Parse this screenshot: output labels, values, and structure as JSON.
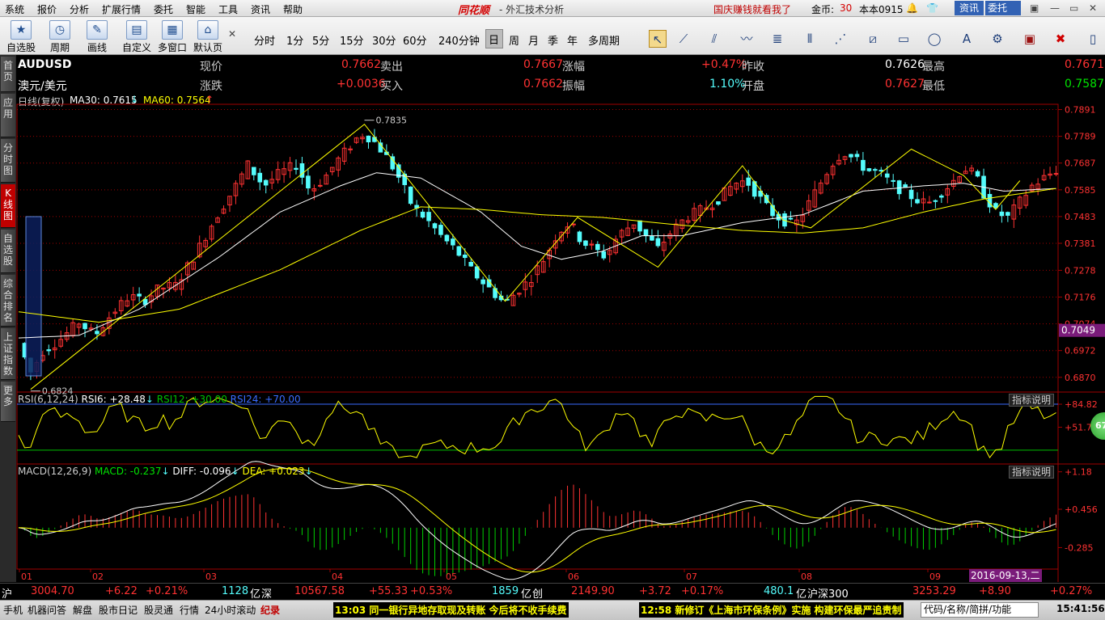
{
  "menubar": {
    "items": [
      "系统",
      "报价",
      "分析",
      "扩展行情",
      "委托",
      "智能",
      "工具",
      "资讯",
      "帮助"
    ],
    "brand": "同花顺",
    "title": "- 外汇技术分析",
    "promo": "国庆赚钱就看我了",
    "coins_label": "金币:",
    "coins": "30",
    "version": "本本0915",
    "btn_news": "资讯",
    "btn_trade": "委托"
  },
  "toolbar": {
    "buttons": [
      "自选股",
      "周期",
      "画线",
      "自定义",
      "多窗口",
      "默认页"
    ],
    "periods": [
      "分时",
      "1分",
      "5分",
      "15分",
      "30分",
      "60分",
      "240分钟",
      "日",
      "周",
      "月",
      "季",
      "年",
      "多周期"
    ]
  },
  "leftbar": {
    "tabs": [
      "首页",
      "应用",
      "分时图",
      "K线图",
      "自选股",
      "综合排名",
      "上证指数",
      "更多"
    ]
  },
  "quote": {
    "symbol": "AUDUSD",
    "name": "澳元/美元",
    "labels": {
      "now": "现价",
      "change": "涨跌",
      "sell": "卖出",
      "buy": "买入",
      "pct": "涨幅",
      "amp": "振幅",
      "prev": "昨收",
      "open": "开盘",
      "high": "最高",
      "low": "最低"
    },
    "now": "0.7662",
    "change": "+0.0036",
    "sell": "0.7667",
    "buy": "0.7662",
    "pct": "+0.47%",
    "amp": "1.10%",
    "prev": "0.7626",
    "open": "0.7627",
    "high": "0.7671",
    "low": "0.7587"
  },
  "kline_header": {
    "label": "日线(复权)",
    "ma30_label": "MA30: 0.7615",
    "ma60_label": "MA60: 0.7564"
  },
  "rsi_header": {
    "name": "RSI(6,12,24)",
    "rsi6": "RSI6: +28.48",
    "rsi12": "RSI12: +30.00",
    "rsi24": "RSI24: +70.00"
  },
  "macd_header": {
    "name": "MACD(12,26,9)",
    "macd": "MACD: -0.237",
    "diff": "DIFF: -0.096",
    "dea": "DEA: +0.023"
  },
  "indicator_btn": "指标说明",
  "round_badge": "67",
  "date_label": "2016-09-13,二",
  "chart_data": [
    {
      "type": "candlestick",
      "yticks": [
        0.7891,
        0.7789,
        0.7687,
        0.7585,
        0.7483,
        0.7381,
        0.7278,
        0.7176,
        0.7074,
        0.6972,
        0.687
      ],
      "ylim": [
        0.682,
        0.7905
      ],
      "xticks": [
        "01",
        "02",
        "03",
        "04",
        "05",
        "06",
        "07",
        "08",
        "09"
      ],
      "price_marker": "0.7049",
      "annot_high": "0.7835",
      "annot_low": "0.6824",
      "close_anchors": [
        [
          0,
          0.7
        ],
        [
          6,
          0.689
        ],
        [
          12,
          0.697
        ],
        [
          20,
          0.701
        ],
        [
          30,
          0.708
        ],
        [
          38,
          0.703
        ],
        [
          46,
          0.711
        ],
        [
          55,
          0.718
        ],
        [
          62,
          0.716
        ],
        [
          70,
          0.721
        ],
        [
          78,
          0.722
        ],
        [
          88,
          0.734
        ],
        [
          98,
          0.748
        ],
        [
          108,
          0.76
        ],
        [
          114,
          0.768
        ],
        [
          122,
          0.76
        ],
        [
          130,
          0.765
        ],
        [
          138,
          0.768
        ],
        [
          145,
          0.758
        ],
        [
          152,
          0.763
        ],
        [
          160,
          0.771
        ],
        [
          168,
          0.778
        ],
        [
          172,
          0.78
        ],
        [
          178,
          0.776
        ],
        [
          184,
          0.77
        ],
        [
          190,
          0.762
        ],
        [
          196,
          0.752
        ],
        [
          202,
          0.748
        ],
        [
          210,
          0.741
        ],
        [
          218,
          0.735
        ],
        [
          226,
          0.727
        ],
        [
          234,
          0.721
        ],
        [
          242,
          0.715
        ],
        [
          248,
          0.72
        ],
        [
          254,
          0.724
        ],
        [
          262,
          0.733
        ],
        [
          268,
          0.742
        ],
        [
          274,
          0.746
        ],
        [
          280,
          0.739
        ],
        [
          286,
          0.736
        ],
        [
          292,
          0.733
        ],
        [
          298,
          0.741
        ],
        [
          306,
          0.746
        ],
        [
          312,
          0.741
        ],
        [
          318,
          0.736
        ],
        [
          324,
          0.742
        ],
        [
          332,
          0.748
        ],
        [
          340,
          0.751
        ],
        [
          348,
          0.755
        ],
        [
          356,
          0.761
        ],
        [
          362,
          0.762
        ],
        [
          368,
          0.756
        ],
        [
          374,
          0.75
        ],
        [
          380,
          0.747
        ],
        [
          386,
          0.745
        ],
        [
          392,
          0.752
        ],
        [
          398,
          0.76
        ],
        [
          404,
          0.768
        ],
        [
          410,
          0.773
        ],
        [
          416,
          0.77
        ],
        [
          422,
          0.766
        ],
        [
          428,
          0.765
        ],
        [
          434,
          0.761
        ],
        [
          440,
          0.758
        ],
        [
          446,
          0.755
        ],
        [
          452,
          0.753
        ],
        [
          458,
          0.757
        ],
        [
          464,
          0.761
        ],
        [
          470,
          0.767
        ],
        [
          476,
          0.764
        ],
        [
          480,
          0.757
        ],
        [
          486,
          0.75
        ],
        [
          492,
          0.748
        ],
        [
          498,
          0.754
        ],
        [
          504,
          0.76
        ],
        [
          510,
          0.763
        ],
        [
          516,
          0.766
        ]
      ],
      "series": [
        {
          "name": "MA30",
          "values_anchor": [
            [
              0,
              0.702
            ],
            [
              30,
              0.703
            ],
            [
              60,
              0.713
            ],
            [
              100,
              0.733
            ],
            [
              130,
              0.75
            ],
            [
              160,
              0.76
            ],
            [
              178,
              0.765
            ],
            [
              200,
              0.763
            ],
            [
              230,
              0.75
            ],
            [
              250,
              0.737
            ],
            [
              270,
              0.732
            ],
            [
              290,
              0.735
            ],
            [
              310,
              0.741
            ],
            [
              330,
              0.741
            ],
            [
              360,
              0.746
            ],
            [
              390,
              0.749
            ],
            [
              420,
              0.758
            ],
            [
              450,
              0.76
            ],
            [
              470,
              0.761
            ],
            [
              490,
              0.758
            ],
            [
              516,
              0.759
            ]
          ]
        },
        {
          "name": "MA60",
          "values_anchor": [
            [
              0,
              0.712
            ],
            [
              40,
              0.708
            ],
            [
              80,
              0.713
            ],
            [
              130,
              0.728
            ],
            [
              170,
              0.743
            ],
            [
              200,
              0.752
            ],
            [
              230,
              0.751
            ],
            [
              260,
              0.749
            ],
            [
              290,
              0.748
            ],
            [
              330,
              0.745
            ],
            [
              360,
              0.743
            ],
            [
              390,
              0.742
            ],
            [
              420,
              0.744
            ],
            [
              450,
              0.75
            ],
            [
              480,
              0.755
            ],
            [
              516,
              0.759
            ]
          ]
        }
      ]
    },
    {
      "type": "line",
      "yticks": [
        "+84.82",
        "+51.75"
      ],
      "ylim": [
        0,
        100
      ],
      "hlines": [
        84.82,
        51.75,
        18.7
      ]
    },
    {
      "type": "bar",
      "yticks": [
        "+1.18",
        "+0.456",
        "-0.285"
      ],
      "ylim": [
        -0.7,
        1.3
      ]
    }
  ],
  "ticker": {
    "sh_label": "沪",
    "sh": "3004.70",
    "sh_chg": "+6.22",
    "sh_pct": "+0.21%",
    "sh_vol": "1128",
    "unit": "亿",
    "sz_label": "深",
    "sz": "10567.58",
    "sz_chg": "+55.33",
    "sz_pct": "+0.53%",
    "sz_vol": "1859",
    "cy_label": "创",
    "cy": "2149.90",
    "cy_chg": "+3.72",
    "cy_pct": "+0.17%",
    "hs_vol": "480.1",
    "hs_label": "沪深300",
    "hs": "3253.29",
    "hs_chg": "+8.90",
    "hs_pct": "+0.27%"
  },
  "statusbar": {
    "items": [
      "手机",
      "机器问答",
      "解盘",
      "股市日记",
      "股灵通",
      "行情",
      "24小时滚动",
      "纪录"
    ],
    "news1": "13:03 同一银行异地存取现及转账  今后将不收手续费",
    "news2": "12:58 新修订《上海市环保条例》实施  构建环保最严追责制",
    "search": "代码/名称/简拼/功能",
    "time": "15:41:56"
  },
  "colors": {
    "up": "#ff3232",
    "down": "#54fcfc",
    "ma30": "#ffffff",
    "ma60": "#ffff00",
    "trend": "#ffff00",
    "grid": "#a00000",
    "yellow_text": "#ffff00",
    "red_text": "#ff3232",
    "green_text": "#00e400",
    "white_text": "#ffffff",
    "cyan_text": "#54fcfc"
  }
}
